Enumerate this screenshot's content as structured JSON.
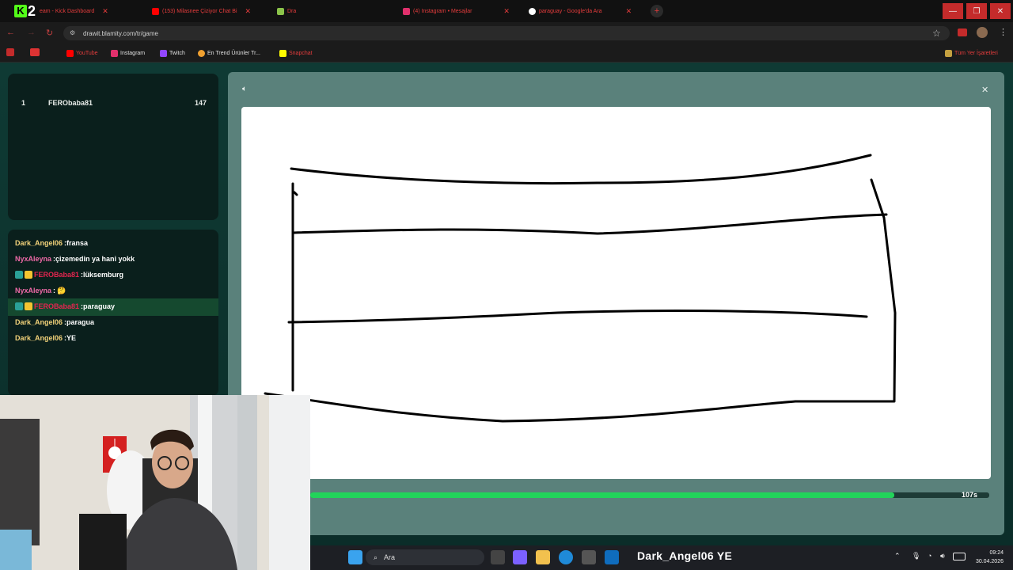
{
  "browser": {
    "tabs": [
      {
        "label": "eam - Kick Dashboard",
        "icon": "kick-icon",
        "color": "#53fc18"
      },
      {
        "label": "(153) Milasnee Çiziyor Chat Bi",
        "icon": "youtube-icon",
        "color": "#ff0000"
      },
      {
        "label": "Dra",
        "icon": "drawit-icon",
        "color": "#8bc34a"
      },
      {
        "label": "(4) Instagram • Mesajlar",
        "icon": "instagram-icon",
        "color": "#e1306c"
      },
      {
        "label": "paraguay - Google'da Ara",
        "icon": "google-icon",
        "color": "#4285f4"
      }
    ],
    "url": "drawit.blamity.com/tr/game",
    "bookmarks": [
      {
        "label": "YouTube",
        "icon": "youtube-icon",
        "color": "#ff0000"
      },
      {
        "label": "Instagram",
        "icon": "instagram-icon",
        "color": "#e1306c"
      },
      {
        "label": "Twitch",
        "icon": "twitch-icon",
        "color": "#9146ff"
      },
      {
        "label": "En Trend Ürünler Tr...",
        "icon": "trend-icon",
        "color": "#f0a030"
      },
      {
        "label": "Snapchat",
        "icon": "snapchat-icon",
        "color": "#fffc00"
      }
    ],
    "all_bookmarks_label": "Tüm Yer İşaretleri"
  },
  "logo": {
    "text": "2"
  },
  "scoreboard": [
    {
      "rank": "1",
      "name": "FERObaba81",
      "score": "147"
    }
  ],
  "chat": [
    {
      "user": "Dark_Angel06",
      "text": ":fransa",
      "user_color": "yellow",
      "badges": false,
      "highlight": false
    },
    {
      "user": "NyxAleyna",
      "text": ":çizemedin ya hani yokk",
      "user_color": "pink",
      "badges": false,
      "highlight": false
    },
    {
      "user": "FEROBaba81",
      "text": ":lüksemburg",
      "user_color": "red",
      "badges": true,
      "highlight": false
    },
    {
      "user": "NyxAleyna",
      "text": ":",
      "user_color": "pink",
      "badges": false,
      "highlight": false,
      "emoji": "🤔"
    },
    {
      "user": "FEROBaba81",
      "text": ":paraguay",
      "user_color": "red",
      "badges": true,
      "highlight": true
    },
    {
      "user": "Dark_Angel06",
      "text": ":paragua",
      "user_color": "yellow",
      "badges": false,
      "highlight": false
    },
    {
      "user": "Dark_Angel06",
      "text": ":YE",
      "user_color": "yellow",
      "badges": false,
      "highlight": false
    }
  ],
  "game": {
    "timer": "107s",
    "progress": 0.86,
    "sound_icon": "speaker-icon",
    "close_icon": "close-icon"
  },
  "taskbar": {
    "search_placeholder": "Ara",
    "overlay_caption": "Dark_Angel06  YE",
    "time": "09:24",
    "date": "30.04.2026"
  },
  "colors": {
    "accent_green": "#22d35a",
    "panel": "#0a1f1c",
    "game_frame": "#5a817b"
  }
}
